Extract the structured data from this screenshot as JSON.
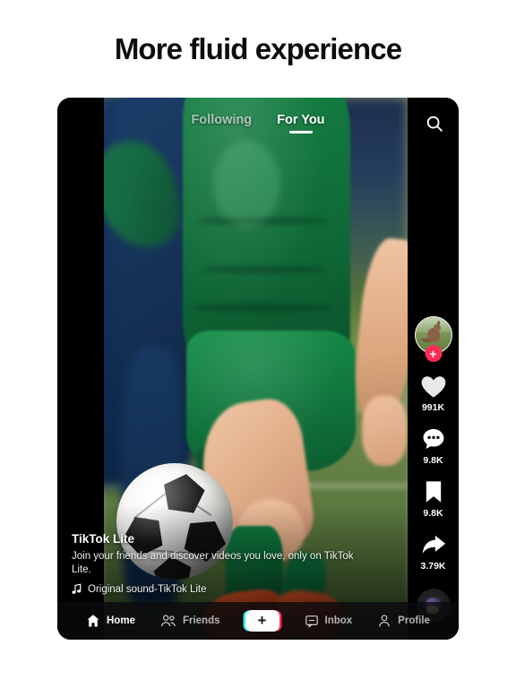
{
  "page": {
    "title": "More fluid experience",
    "background_color": "#ffffff"
  },
  "app": {
    "top_nav": {
      "tabs": [
        {
          "label": "Following",
          "active": false
        },
        {
          "label": "For You",
          "active": true
        }
      ],
      "search_icon": "search-icon"
    },
    "video": {
      "description": "Soccer player in green kit dribbling a ball on a grass pitch",
      "letterboxed": true
    },
    "action_rail": {
      "avatar": {
        "icon": "avatar-kangaroo",
        "follow_badge": "+"
      },
      "actions": [
        {
          "icon": "heart-icon",
          "count": "991K"
        },
        {
          "icon": "comment-icon",
          "count": "9.8K"
        },
        {
          "icon": "bookmark-icon",
          "count": "9.8K"
        },
        {
          "icon": "share-icon",
          "count": "3.79K"
        }
      ],
      "music_disc": "music-disc-icon"
    },
    "caption": {
      "author": "TikTok Lite",
      "text": "Join your friends and discover videos you love, only on TikTok Lite.",
      "music_icon": "music-note-icon",
      "music_label": "Original sound-TikTok Lite"
    },
    "bottom_nav": {
      "items": [
        {
          "label": "Home",
          "icon": "home-icon",
          "active": true
        },
        {
          "label": "Friends",
          "icon": "friends-icon",
          "active": false
        },
        {
          "label": "Inbox",
          "icon": "inbox-icon",
          "active": false
        },
        {
          "label": "Profile",
          "icon": "profile-icon",
          "active": false
        }
      ],
      "create_button": {
        "icon": "plus-icon",
        "label": "+"
      }
    },
    "colors": {
      "accent_pink": "#fe2c55",
      "accent_cyan": "#25f4ee",
      "background": "#050507",
      "text_primary": "#ffffff"
    }
  }
}
